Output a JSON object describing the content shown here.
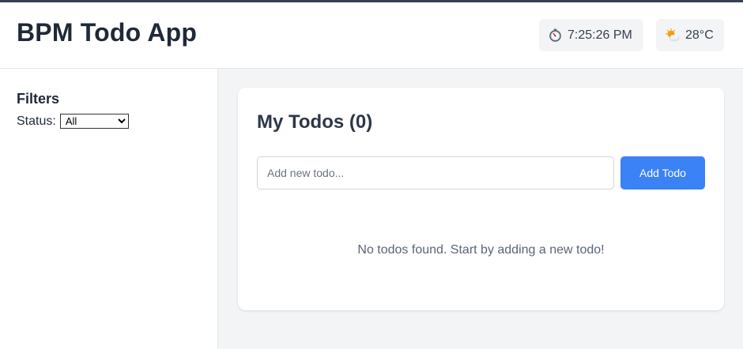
{
  "header": {
    "title": "BPM Todo App",
    "clock": {
      "icon": "stopwatch-icon",
      "time": "7:25:26 PM"
    },
    "weather": {
      "icon": "sun-behind-cloud-icon",
      "temperature": "28°C"
    }
  },
  "sidebar": {
    "title": "Filters",
    "status_label": "Status:",
    "status_selected": "All"
  },
  "main": {
    "title": "My Todos (0)",
    "input_placeholder": "Add new todo...",
    "add_button_label": "Add Todo",
    "empty_message": "No todos found. Start by adding a new todo!"
  },
  "colors": {
    "accent": "#3b82f6",
    "page_background": "#f3f4f6",
    "card_background": "#ffffff"
  }
}
